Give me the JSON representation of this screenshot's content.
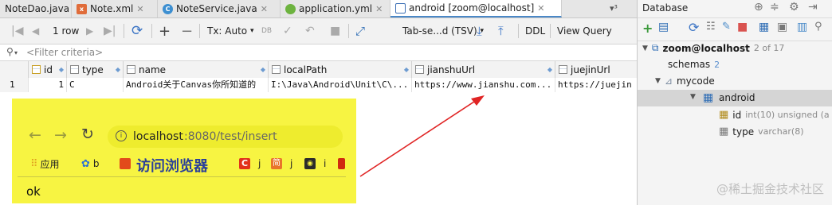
{
  "tabs": [
    {
      "label": "NoteDao.java",
      "icon": "java-interface-icon",
      "color": "#5aa35a"
    },
    {
      "label": "Note.xml",
      "icon": "xml-file-icon",
      "color": "#e06c3a"
    },
    {
      "label": "NoteService.java",
      "icon": "java-class-icon",
      "color": "#3d8fd1"
    },
    {
      "label": "application.yml",
      "icon": "spring-leaf-icon",
      "color": "#6db33f"
    },
    {
      "label": "android [zoom@localhost]",
      "icon": "table-icon",
      "color": "#3d6fb5"
    }
  ],
  "tab_overflow": "▾³",
  "toolbar": {
    "row_count": "1 row",
    "tx_mode": "Tx: Auto",
    "export_format": "Tab-se...d (TSV)",
    "ddl": "DDL",
    "view_query": "View Query"
  },
  "filter": {
    "placeholder": "<Filter criteria>"
  },
  "grid": {
    "columns": [
      "id",
      "type",
      "name",
      "localPath",
      "jianshuUrl",
      "juejinUrl"
    ],
    "rows": [
      {
        "num": "1",
        "cells": [
          "1",
          "C",
          "Android关于Canvas你所知道的",
          "I:\\Java\\Android\\Unit\\C\\...",
          "https://www.jianshu.com...",
          "https://juejin"
        ]
      }
    ]
  },
  "database": {
    "title": "Database",
    "tree": {
      "server": "zoom@localhost",
      "server_count": "2 of 17",
      "schemas": "schemas",
      "schemas_count": "2",
      "db": "mycode",
      "table": "android",
      "columns": [
        {
          "name": "id",
          "type": "int(10) unsigned (a"
        },
        {
          "name": "type",
          "type": "varchar(8)"
        }
      ]
    }
  },
  "browser": {
    "url_host": "localhost",
    "url_port_path": ":8080/test/insert",
    "bookmarks": [
      {
        "label": "应用",
        "icon": "apps-grid-icon",
        "color": "#e0a020"
      },
      {
        "label": "b",
        "icon": "paw-icon",
        "color": "#2a6fd6"
      },
      {
        "label": "",
        "icon": "bookmark-red-icon",
        "color": "#e24a1b"
      },
      {
        "label": "j",
        "icon": "bookmark-c-icon",
        "color": "#e2321b"
      },
      {
        "label": "j",
        "icon": "bookmark-jian-icon",
        "color": "#e9752a"
      },
      {
        "label": "i",
        "icon": "bookmark-dark-icon",
        "color": "#2b2b2b"
      },
      {
        "label": "",
        "icon": "bookmark-red-edge-icon",
        "color": "#d02a10"
      }
    ],
    "annotation": "访问浏览器",
    "page_text": "ok"
  },
  "watermark": "@稀土掘金技术社区",
  "colors": {
    "highlight": "#f7f442",
    "arrow": "#e02424",
    "annotation": "#2a3f9a"
  }
}
